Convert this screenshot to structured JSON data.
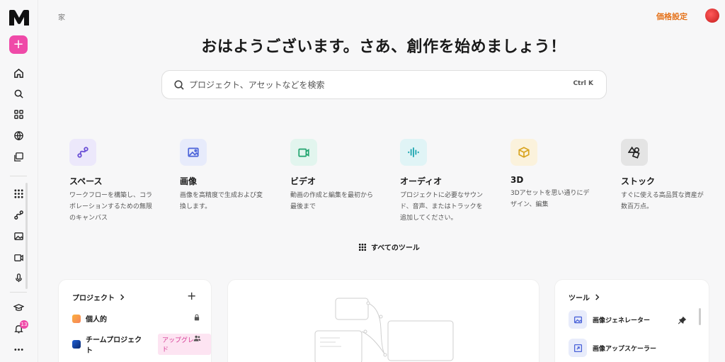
{
  "sidebar": {
    "notification_count": "13"
  },
  "header": {
    "breadcrumb": "家",
    "pricing": "価格設定"
  },
  "greeting": "おはようございます。さあ、創作を始めましょう！",
  "search": {
    "placeholder": "プロジェクト、アセットなどを検索",
    "shortcut": "Ctrl K"
  },
  "tools": [
    {
      "title": "スペース",
      "desc": "ワークフローを構築し、コラボレーションするための無限のキャンバス",
      "bg": "#ece8fb",
      "color": "#6a4fd6"
    },
    {
      "title": "画像",
      "desc": "画像を高精度で生成および変換します。",
      "bg": "#e7ebfb",
      "color": "#4b63d9"
    },
    {
      "title": "ビデオ",
      "desc": "動画の作成と編集を最初から最後まで",
      "bg": "#e2f5ee",
      "color": "#20a46e"
    },
    {
      "title": "オーディオ",
      "desc": "プロジェクトに必要なサウンド、音声、またはトラックを追加してください。",
      "bg": "#e0f4f6",
      "color": "#1aa5b0"
    },
    {
      "title": "3D",
      "desc": "3Dアセットを思い通りにデザイン、編集",
      "bg": "#fbf2dc",
      "color": "#d9a420"
    },
    {
      "title": "ストック",
      "desc": "すぐに使える高品質な資産が数百万点。",
      "bg": "#e4e4e4",
      "color": "#222222"
    }
  ],
  "all_tools_label": "すべてのツール",
  "projects": {
    "title": "プロジェクト",
    "personal": "個人的",
    "team": "チームプロジェクト",
    "upgrade": "アップグレード"
  },
  "tool_panel": {
    "title": "ツール",
    "items": [
      "画像ジェネレーター",
      "画像アップスケーラー"
    ]
  }
}
